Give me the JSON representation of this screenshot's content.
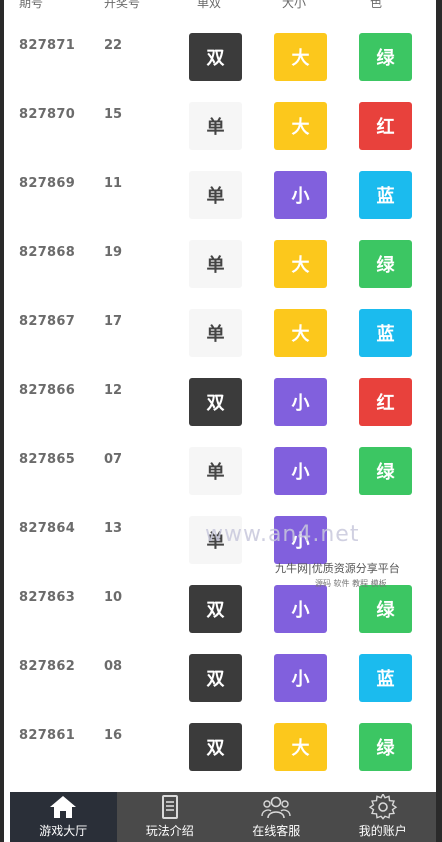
{
  "header": {
    "columns": [
      "期号",
      "开奖号",
      "单双",
      "大小",
      "色"
    ]
  },
  "rows": [
    {
      "issue": "827871",
      "sum": "22",
      "parity": "双",
      "size": "大",
      "color_label": "绿",
      "parity_style": "shuang",
      "size_style": "da",
      "color_style": "green"
    },
    {
      "issue": "827870",
      "sum": "15",
      "parity": "单",
      "size": "大",
      "color_label": "红",
      "parity_style": "dan",
      "size_style": "da",
      "color_style": "red"
    },
    {
      "issue": "827869",
      "sum": "11",
      "parity": "单",
      "size": "小",
      "color_label": "蓝",
      "parity_style": "dan",
      "size_style": "xiao",
      "color_style": "blue"
    },
    {
      "issue": "827868",
      "sum": "19",
      "parity": "单",
      "size": "大",
      "color_label": "绿",
      "parity_style": "dan",
      "size_style": "da",
      "color_style": "green"
    },
    {
      "issue": "827867",
      "sum": "17",
      "parity": "单",
      "size": "大",
      "color_label": "蓝",
      "parity_style": "dan",
      "size_style": "da",
      "color_style": "blue"
    },
    {
      "issue": "827866",
      "sum": "12",
      "parity": "双",
      "size": "小",
      "color_label": "红",
      "parity_style": "shuang",
      "size_style": "xiao",
      "color_style": "red"
    },
    {
      "issue": "827865",
      "sum": "07",
      "parity": "单",
      "size": "小",
      "color_label": "绿",
      "parity_style": "dan",
      "size_style": "xiao",
      "color_style": "green"
    },
    {
      "issue": "827864",
      "sum": "13",
      "parity": "单",
      "size": "小",
      "color_label": "",
      "parity_style": "dan",
      "size_style": "xiao",
      "color_style": "none"
    },
    {
      "issue": "827863",
      "sum": "10",
      "parity": "双",
      "size": "小",
      "color_label": "绿",
      "parity_style": "shuang",
      "size_style": "xiao",
      "color_style": "green"
    },
    {
      "issue": "827862",
      "sum": "08",
      "parity": "双",
      "size": "小",
      "color_label": "蓝",
      "parity_style": "shuang",
      "size_style": "xiao",
      "color_style": "blue"
    },
    {
      "issue": "827861",
      "sum": "16",
      "parity": "双",
      "size": "大",
      "color_label": "绿",
      "parity_style": "shuang",
      "size_style": "da",
      "color_style": "green"
    }
  ],
  "watermark": {
    "main": "www.an4.net",
    "sub": "九牛网|优质资源分享平台",
    "sub2": "源码 软件 教程 模板"
  },
  "tabbar": {
    "items": [
      {
        "label": "游戏大厅",
        "icon": "home-icon",
        "active": true
      },
      {
        "label": "玩法介绍",
        "icon": "document-icon",
        "active": false
      },
      {
        "label": "在线客服",
        "icon": "group-icon",
        "active": false
      },
      {
        "label": "我的账户",
        "icon": "gear-icon",
        "active": false
      }
    ]
  },
  "colors": {
    "shuang": "#3b3b3b",
    "dan": "#f6f6f6",
    "da": "#fcc81c",
    "xiao": "#8160dd",
    "green": "#3cc663",
    "red": "#e8413c",
    "blue": "#1bbbee",
    "tabbar": "#4a4a4a",
    "tab_active": "#2a2f38"
  }
}
